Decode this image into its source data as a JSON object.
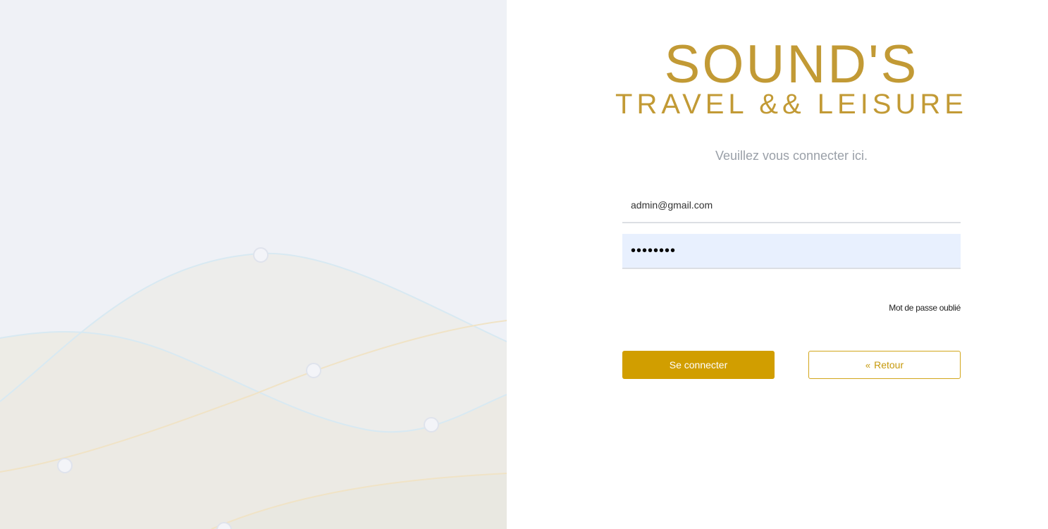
{
  "brand": {
    "title": "SOUND'S",
    "subtitle": "TRAVEL && LEISURE",
    "color": "#c29a35"
  },
  "form": {
    "prompt": "Veuillez vous connecter ici.",
    "email_value": "admin@gmail.com",
    "password_value": "Password",
    "forgot_password_label": "Mot de passe oublié",
    "login_button_label": "Se connecter",
    "back_button_label": "Retour",
    "back_icon": "double-chevron-left-icon",
    "accent_color": "#d19e00"
  }
}
